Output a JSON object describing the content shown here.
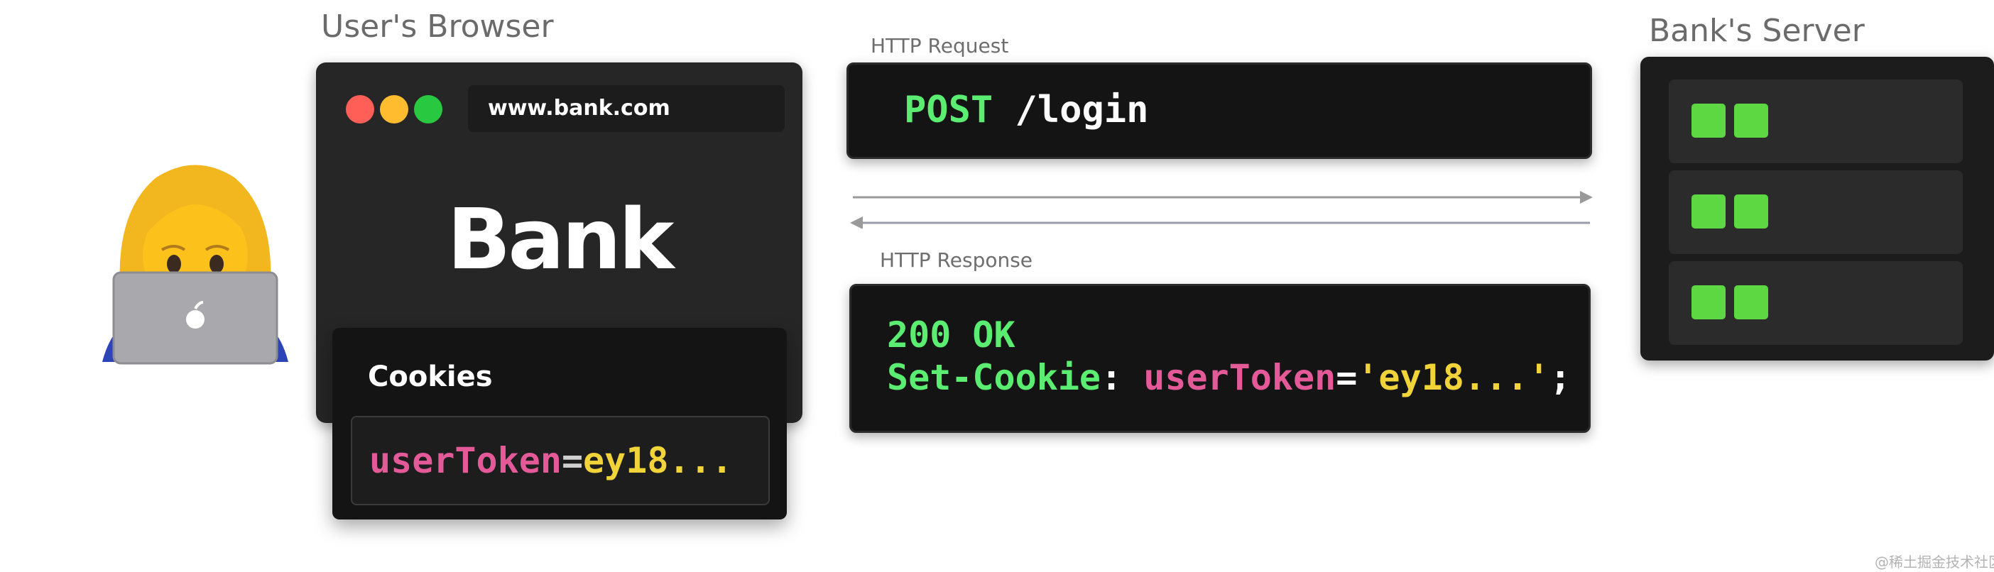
{
  "browser_section": {
    "title": "User's Browser",
    "url": "www.bank.com",
    "logo_text": "Bank",
    "window_dots": [
      "#ff5f57",
      "#febc2e",
      "#28c840"
    ],
    "cookies": {
      "title": "Cookies",
      "entry": {
        "key": "userToken",
        "equals": "=",
        "value": "ey18..."
      }
    }
  },
  "server_section": {
    "title": "Bank's Server",
    "racks": 3,
    "led_color": "#5ed842"
  },
  "request": {
    "label": "HTTP Request",
    "method": "POST",
    "path": "/login"
  },
  "response": {
    "label": "HTTP Response",
    "status": "200 OK",
    "header_name": "Set-Cookie",
    "header_colon": ":",
    "cookie_key": "userToken",
    "equals": "=",
    "cookie_value": "'ey18...'",
    "semicolon": ";"
  },
  "user": {
    "icon": "woman-technologist-icon"
  },
  "watermark": "@稀土掘金技术社区",
  "colors": {
    "keyword_green": "#5bed72",
    "key_pink": "#e45a99",
    "value_yellow": "#f1d33a",
    "arrow_gray": "#9a9a9a"
  }
}
